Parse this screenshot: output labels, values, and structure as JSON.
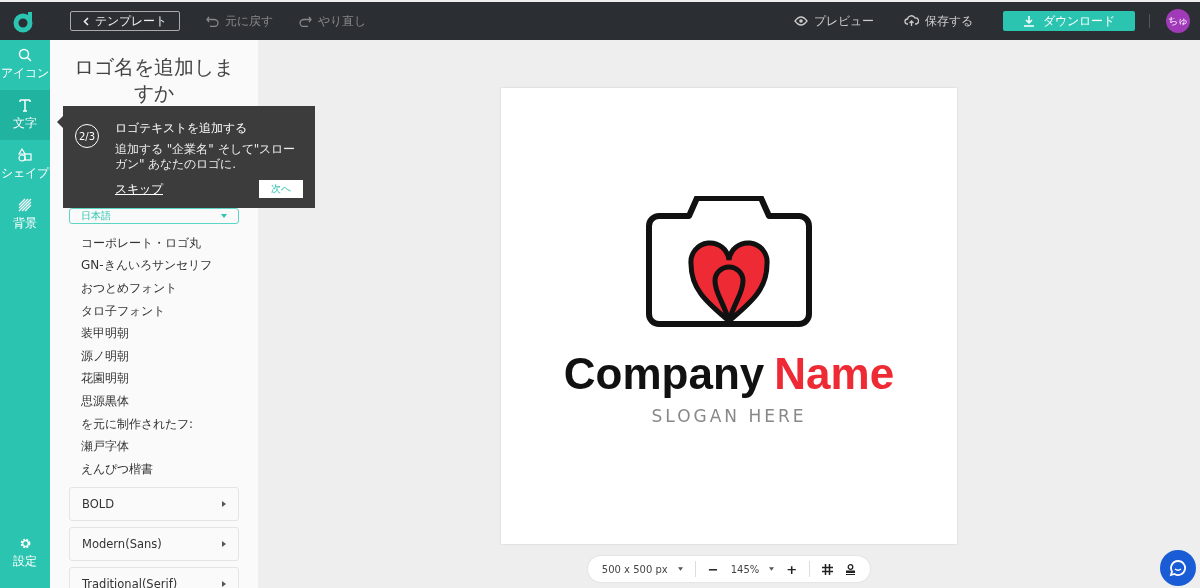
{
  "topbar": {
    "back_button": "テンプレート",
    "undo": "元に戻す",
    "redo": "やり直し",
    "preview": "プレビュー",
    "save": "保存する",
    "download": "ダウンロード",
    "avatar": "ちゅ"
  },
  "rail": {
    "items": [
      {
        "kind": "search",
        "label": "アイコン",
        "selected": false
      },
      {
        "kind": "text",
        "label": "文字",
        "selected": true
      },
      {
        "kind": "shape",
        "label": "シェイプ",
        "selected": false
      },
      {
        "kind": "background",
        "label": "背景",
        "selected": false
      }
    ],
    "settings": "設定"
  },
  "panel": {
    "heading": "ロゴ名を追加しますか",
    "language_dropdown": "日本語",
    "fonts": [
      "コーポレート・ロゴ丸",
      "GN-きんいろサンセリフ",
      "おつとめフォント",
      "タロ子フォント",
      "装甲明朝",
      "源ノ明朝",
      "花園明朝",
      "思源黒体",
      "を元に制作されたフ:",
      "瀬戸字体",
      "えんぴつ楷書"
    ],
    "categories": [
      "BOLD",
      "Modern(Sans)",
      "Traditional(Serif)"
    ]
  },
  "tooltip": {
    "step": "2/3",
    "title": "ロゴテキストを追加する",
    "body": "追加する \"企業名\" そして\"スローガン\" あなたのロゴに.",
    "skip": "スキップ",
    "next": "次へ"
  },
  "logo": {
    "company_words": [
      {
        "text": "Company",
        "color": "#111111"
      },
      {
        "text": "Name",
        "color": "#ee2a35"
      }
    ],
    "slogan": "SLOGAN HERE"
  },
  "zoombar": {
    "size": "500 x 500 px",
    "minus": "−",
    "zoom": "145%",
    "plus": "+"
  }
}
